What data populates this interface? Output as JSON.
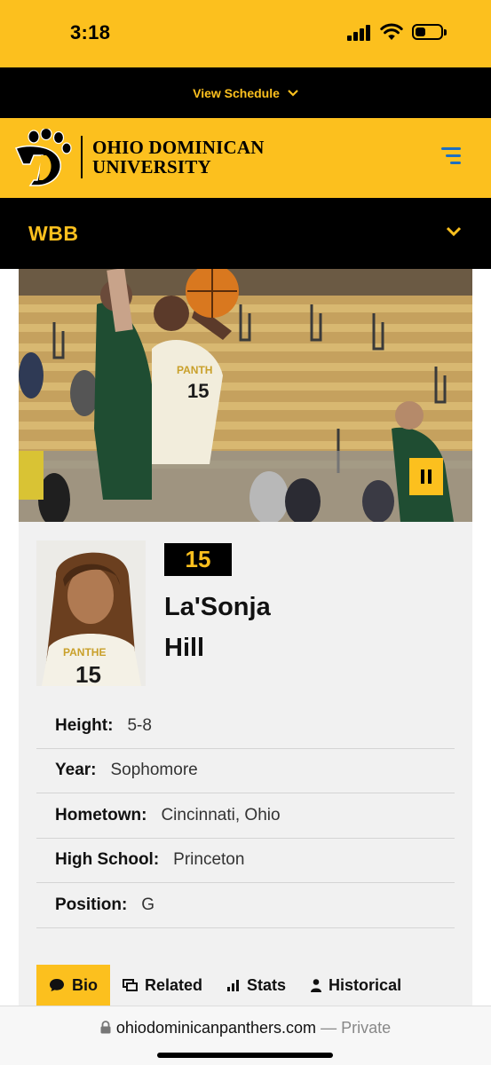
{
  "status_bar": {
    "time": "3:18"
  },
  "schedule_bar": {
    "label": "View Schedule"
  },
  "header": {
    "logo_line1": "OHIO DOMINICAN",
    "logo_line2": "UNIVERSITY"
  },
  "team_nav": {
    "label": "WBB"
  },
  "player": {
    "number": "15",
    "first_name": "La'Sonja",
    "last_name": "Hill",
    "bio": [
      {
        "label": "Height:",
        "value": "5-8"
      },
      {
        "label": "Year:",
        "value": "Sophomore"
      },
      {
        "label": "Hometown:",
        "value": "Cincinnati, Ohio"
      },
      {
        "label": "High School:",
        "value": "Princeton"
      },
      {
        "label": "Position:",
        "value": "G"
      }
    ]
  },
  "tabs": [
    {
      "label": "Bio",
      "icon": "comment-icon",
      "active": true
    },
    {
      "label": "Related",
      "icon": "gallery-icon",
      "active": false
    },
    {
      "label": "Stats",
      "icon": "bar-chart-icon",
      "active": false
    },
    {
      "label": "Historical",
      "icon": "person-icon",
      "active": false
    }
  ],
  "browser": {
    "domain": "ohiodominicanpanthers.com",
    "suffix": "— Private"
  },
  "colors": {
    "gold": "#fcc01e",
    "black": "#000000",
    "menu_blue": "#1d6fc0",
    "card_bg": "#f1f1f1"
  }
}
